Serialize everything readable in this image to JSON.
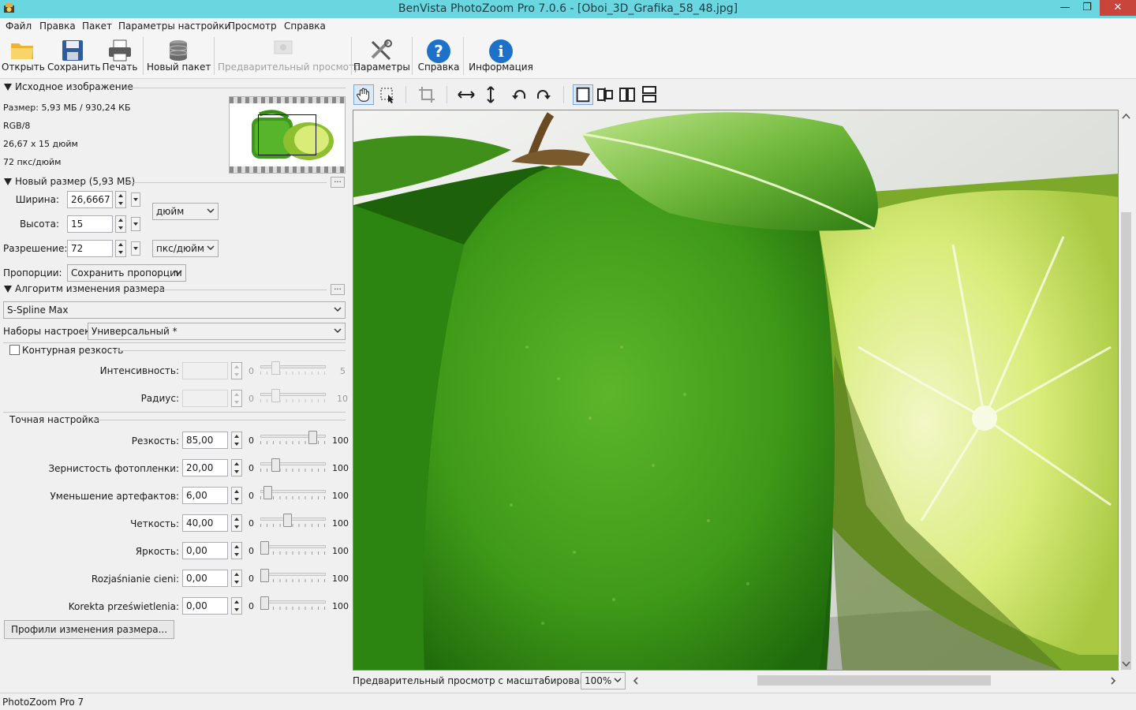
{
  "window": {
    "title": "BenVista PhotoZoom Pro 7.0.6 - [Oboi_3D_Grafika_58_48.jpg]"
  },
  "menu": [
    "Файл",
    "Правка",
    "Пакет",
    "Параметры настройки",
    "Просмотр",
    "Справка"
  ],
  "toolbar": {
    "open": "Открыть",
    "save": "Сохранить",
    "print": "Печать",
    "batch": "Новый пакет",
    "preview": "Предварительный просмотр",
    "settings": "Параметры",
    "help": "Справка",
    "info": "Информация"
  },
  "source": {
    "header": "Исходное изображение",
    "size": "Размер: 5,93 МБ / 930,24 КБ",
    "mode": "RGB/8",
    "dimensions": "26,67 x 15 дюйм",
    "dpi": "72 пкс/дюйм"
  },
  "new_size": {
    "header": "Новый размер (5,93 МБ)",
    "width_label": "Ширина:",
    "width": "26,6667",
    "height_label": "Высота:",
    "height": "15",
    "unit": "дюйм",
    "resolution_label": "Разрешение:",
    "resolution": "72",
    "resolution_unit": "пкс/дюйм",
    "proportions_label": "Пропорции:",
    "proportions": "Сохранить пропорции"
  },
  "algorithm": {
    "header": "Алгоритм изменения размера",
    "method": "S-Spline Max",
    "presets_label": "Наборы настроек:",
    "preset": "Универсальный *"
  },
  "edge_sharpness": {
    "label": "Контурная резкость",
    "checked": false,
    "intensity_label": "Интенсивность:",
    "intensity_min": "0",
    "intensity_max": "5",
    "intensity_level": 0.2,
    "radius_label": "Радиус:",
    "radius_min": "0",
    "radius_max": "10",
    "radius_level": 0.2
  },
  "fine_tune": {
    "header": "Точная настройка",
    "rows": [
      {
        "label": "Резкость:",
        "value": "85,00",
        "min": "0",
        "max": "100",
        "level": 0.85
      },
      {
        "label": "Зернистость фотопленки:",
        "value": "20,00",
        "min": "0",
        "max": "100",
        "level": 0.2
      },
      {
        "label": "Уменьшение артефактов:",
        "value": "6,00",
        "min": "0",
        "max": "100",
        "level": 0.06
      },
      {
        "label": "Четкость:",
        "value": "40,00",
        "min": "0",
        "max": "100",
        "level": 0.4
      },
      {
        "label": "Яркость:",
        "value": "0,00",
        "min": "0",
        "max": "100",
        "level": 0
      },
      {
        "label": "Rozjaśnianie cieni:",
        "value": "0,00",
        "min": "0",
        "max": "100",
        "level": 0
      },
      {
        "label": "Korekta prześwietlenia:",
        "value": "0,00",
        "min": "0",
        "max": "100",
        "level": 0
      }
    ]
  },
  "profiles_button": "Профили изменения размера...",
  "preview": {
    "zoom_label": "Предварительный просмотр с масштабированием:",
    "zoom": "100%"
  },
  "status": "PhotoZoom Pro 7",
  "colors": {
    "titlebar": "#6ad6df",
    "close": "#c7453a",
    "lime_dark": "#2f7d12",
    "lime_light": "#d9ec7a"
  }
}
